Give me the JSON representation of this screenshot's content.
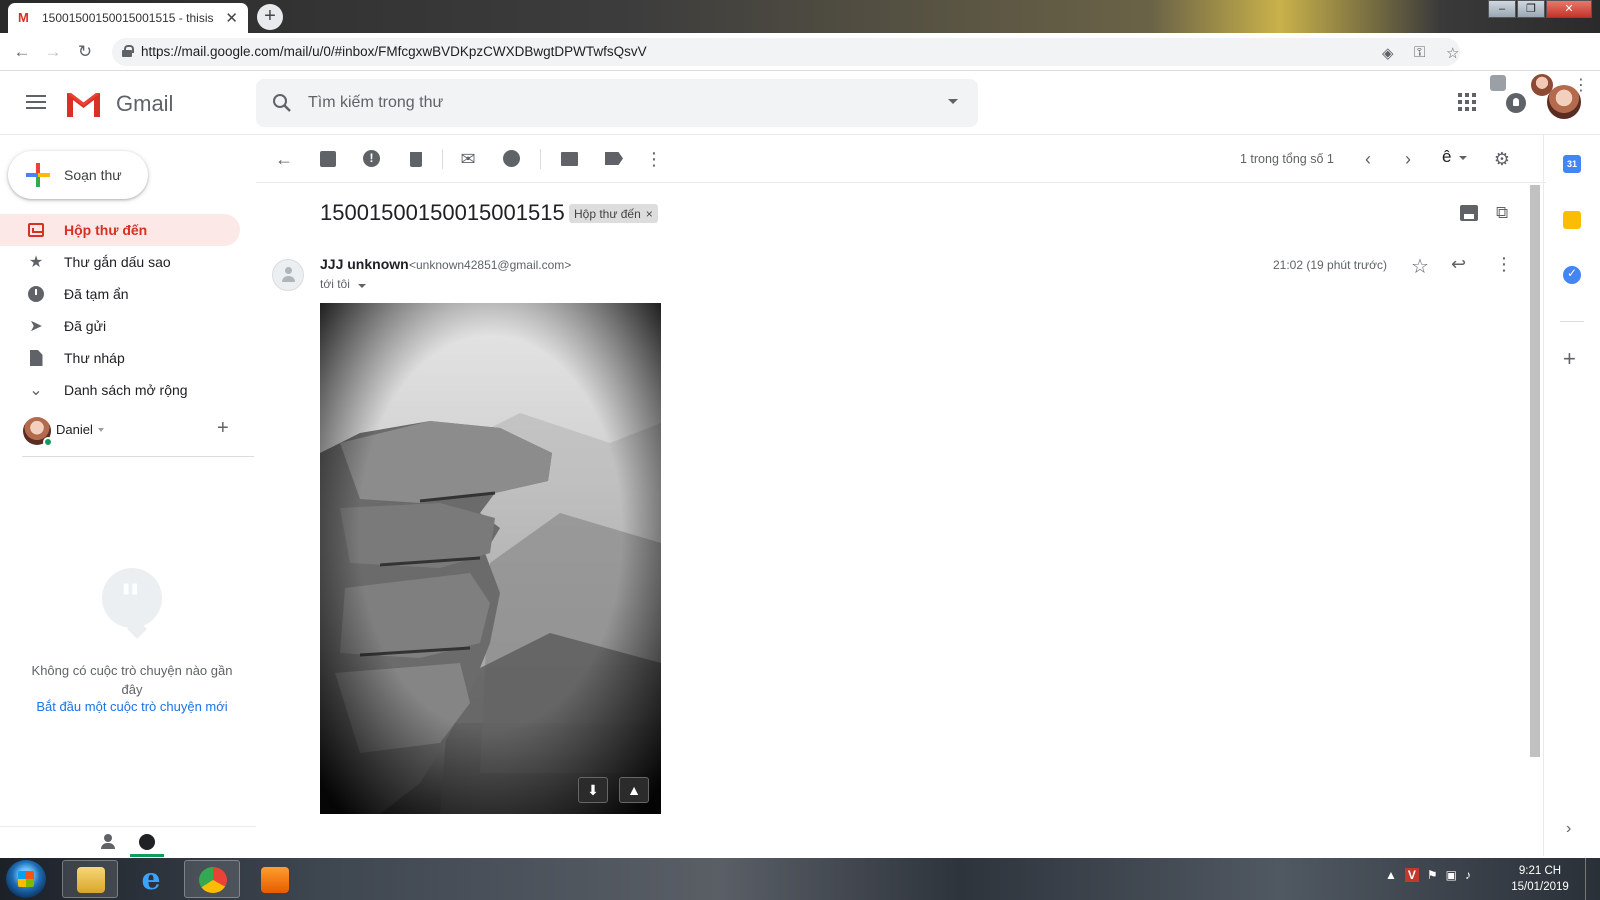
{
  "browser": {
    "tab_title": "15001500150015001515 - thisis",
    "tab_favicon": "M",
    "tab_close": "✕",
    "new_tab": "+",
    "url": "https://mail.google.com/mail/u/0/#inbox/FMfcgxwBVDKpzCWXDBwgtDPWTwfsQsvV",
    "window_minimize": "–",
    "window_restore": "❐",
    "window_close": "✕"
  },
  "header": {
    "app_name": "Gmail",
    "search_placeholder": "Tìm kiếm trong thư"
  },
  "sidebar": {
    "compose_label": "Soạn thư",
    "items": [
      {
        "label": "Hộp thư đến",
        "icon": "inbox-icon",
        "active": true
      },
      {
        "label": "Thư gắn dấu sao",
        "icon": "star-icon"
      },
      {
        "label": "Đã tạm ẩn",
        "icon": "snooze-icon"
      },
      {
        "label": "Đã gửi",
        "icon": "send-icon"
      },
      {
        "label": "Thư nháp",
        "icon": "draft-icon"
      },
      {
        "label": "Danh sách mở rộng",
        "icon": "chevron-down-icon"
      }
    ],
    "hangouts_user": "Daniel",
    "hangouts_add": "+",
    "no_chat_text": "Không có cuộc trò chuyện nào gần đây",
    "start_chat_link": "Bắt đầu một cuộc trò chuyện mới"
  },
  "toolbar": {
    "pager_text": "1 trong tổng số 1",
    "input_lang": "ê"
  },
  "message": {
    "subject": "15001500150015001515",
    "label_chip": "Hộp thư đến",
    "label_chip_remove": "×",
    "sender_name": "JJJ unknown",
    "sender_email": "<unknown42851@gmail.com>",
    "to_text": "tới tôi",
    "time": "21:02 (19 phút trước)",
    "attachment": {
      "description": "black and white photo of overhanging rock cliff",
      "download_icon": "⬇",
      "drive_icon": "▲"
    }
  },
  "right_panel": {
    "calendar_label": "31"
  },
  "taskbar": {
    "clock_time": "9:21 CH",
    "clock_date": "15/01/2019"
  },
  "colors": {
    "accent_red": "#d93025",
    "active_bg": "#fce8e6",
    "link_blue": "#1a73e8",
    "text_secondary": "#5f6368"
  }
}
